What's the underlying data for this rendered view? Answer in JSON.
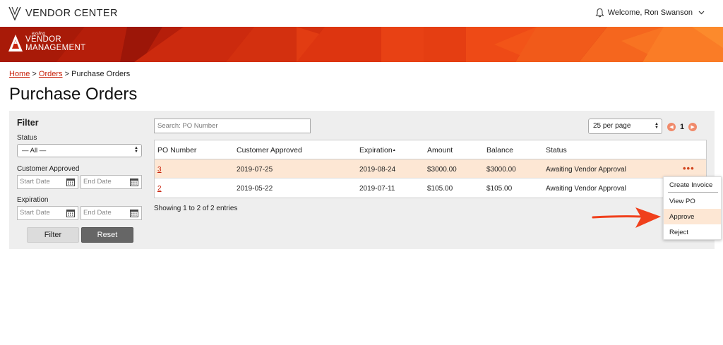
{
  "app": {
    "title": "VENDOR CENTER",
    "welcome": "Welcome, Ron Swanson"
  },
  "banner": {
    "logo_small": "eysling",
    "logo_line1": "VENDOR",
    "logo_line2": "MANAGEMENT"
  },
  "breadcrumb": {
    "home": "Home",
    "sep1": ">",
    "orders": "Orders",
    "sep2": ">",
    "current": "Purchase Orders"
  },
  "page": {
    "title": "Purchase Orders"
  },
  "filter": {
    "title": "Filter",
    "status_label": "Status",
    "status_value": "— All —",
    "customer_approved_label": "Customer Approved",
    "expiration_label": "Expiration",
    "start_placeholder": "Start Date",
    "end_placeholder": "End Date",
    "filter_button": "Filter",
    "reset_button": "Reset"
  },
  "search": {
    "placeholder": "Search: PO Number"
  },
  "pagination": {
    "per_page": "25 per page",
    "current_page": "1"
  },
  "table": {
    "headers": [
      "PO Number",
      "Customer Approved",
      "Expiration",
      "Amount",
      "Balance",
      "Status"
    ],
    "sort_indicator": "▲",
    "rows": [
      {
        "po": "3",
        "customer_approved": "2019-07-25",
        "expiration": "2019-08-24",
        "amount": "$3000.00",
        "balance": "$3000.00",
        "status": "Awaiting Vendor Approval",
        "actions": "•••"
      },
      {
        "po": "2",
        "customer_approved": "2019-05-22",
        "expiration": "2019-07-11",
        "amount": "$105.00",
        "balance": "$105.00",
        "status": "Awaiting Vendor Approval",
        "actions": ""
      }
    ],
    "footer": "Showing 1 to 2 of 2 entries"
  },
  "actions_menu": {
    "items": [
      "Create Invoice",
      "View PO",
      "Approve",
      "Reject"
    ],
    "selected": "Approve"
  },
  "colors": {
    "brand_red": "#c8220b",
    "highlight": "#fde7d4",
    "arrow": "#f0401c"
  }
}
